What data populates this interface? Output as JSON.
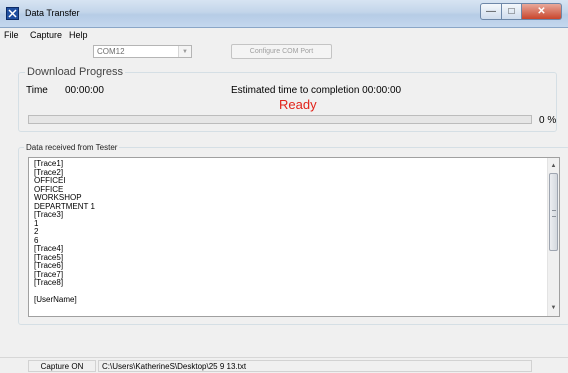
{
  "window": {
    "title": "Data Transfer"
  },
  "menu": {
    "items": [
      "File",
      "Capture",
      "Help"
    ]
  },
  "toolbar": {
    "port_value": "COM12",
    "configure_label": "Configure COM Port"
  },
  "download": {
    "group_label": "Download Progress",
    "time_label": "Time",
    "time_value": "00:00:00",
    "eta_label": "Estimated time to completion 00:00:00",
    "status": "Ready",
    "progress_percent": 0,
    "progress_label": "0 %"
  },
  "data": {
    "group_label": "Data received from Tester",
    "lines": [
      "[Trace1]",
      "[Trace2]",
      "OFFICEI",
      "OFFICE",
      "WORKSHOP",
      "DEPARTMENT 1",
      "[Trace3]",
      "1",
      "2",
      "6",
      "[Trace4]",
      "[Trace5]",
      "[Trace6]",
      "[Trace7]",
      "[Trace8]",
      "",
      "[UserName]"
    ]
  },
  "status_bar": {
    "capture": "Capture ON",
    "path": "C:\\Users\\KatherineS\\Desktop\\25 9 13.txt"
  },
  "colors": {
    "ready": "#e2231a",
    "close_button": "#c9452c",
    "titlebar": "#c3d5ea"
  },
  "icons": [
    "app-icon",
    "minimize-icon",
    "maximize-icon",
    "close-icon",
    "chevron-down-icon",
    "scroll-up-icon",
    "scroll-down-icon"
  ]
}
